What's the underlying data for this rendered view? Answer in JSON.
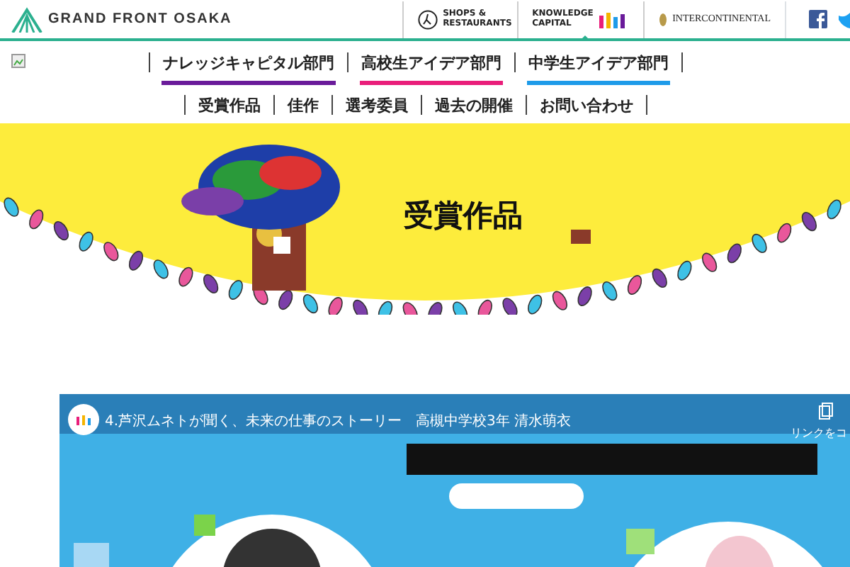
{
  "header": {
    "logo": "GRAND FRONT OSAKA",
    "links": [
      {
        "label": "SHOPS & RESTAURANTS",
        "kind": "shops",
        "selected": false
      },
      {
        "label": "KNOWLEDGE CAPITAL",
        "kind": "knowledge",
        "selected": true
      },
      {
        "label": "INTERCONTINENTAL",
        "kind": "hotel",
        "selected": false
      }
    ]
  },
  "nav": {
    "items": [
      {
        "label": "ナレッジキャピタル部門",
        "color": "#6a1b9a"
      },
      {
        "label": "高校生アイデア部門",
        "color": "#e91e7a"
      },
      {
        "label": "中学生アイデア部門",
        "color": "#1e9be9"
      },
      {
        "label": "受賞作品"
      },
      {
        "label": "佳作"
      },
      {
        "label": "選考委員"
      },
      {
        "label": "過去の開催"
      },
      {
        "label": "お問い合わせ"
      }
    ]
  },
  "banner": {
    "title": "受賞作品"
  },
  "video": {
    "title": "4.芦沢ムネトが聞く、未来の仕事のストーリー　高槻中学校3年 清水萌衣",
    "action": "リンクをコ"
  }
}
